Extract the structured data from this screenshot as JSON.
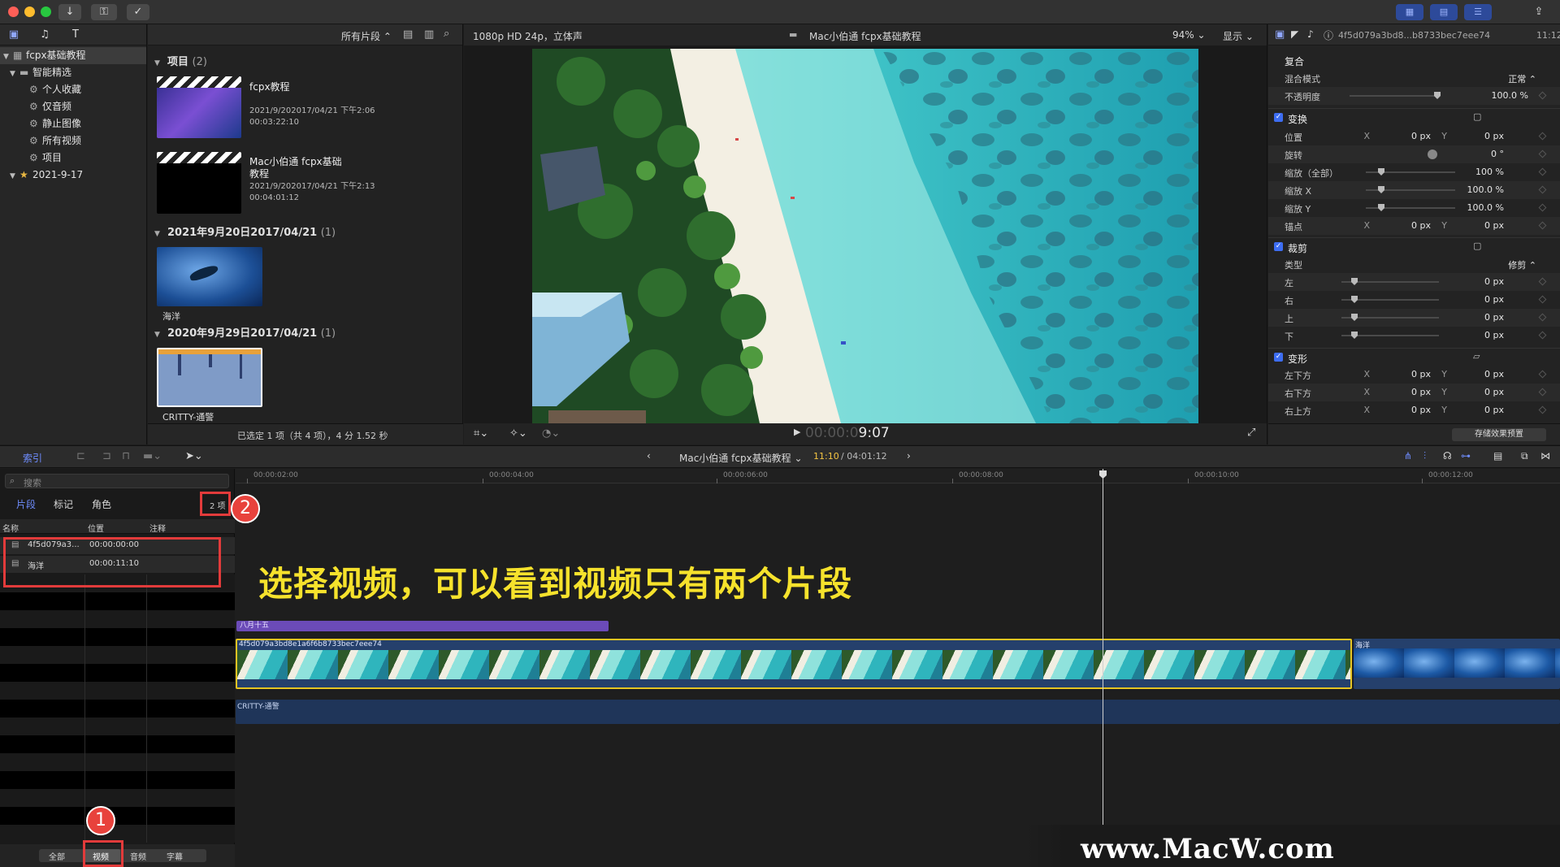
{
  "titlebar": {
    "icons": [
      "download-icon",
      "key-icon",
      "check-circle-icon"
    ],
    "right_icons": [
      "grid-icon",
      "list-icon",
      "sliders-icon",
      "share-icon"
    ]
  },
  "library": {
    "items": [
      {
        "label": "fcpx基础教程",
        "icon": "library-icon",
        "selected": true
      },
      {
        "label": "智能精选",
        "icon": "folder-icon"
      },
      {
        "label": "个人收藏",
        "icon": "gear-icon"
      },
      {
        "label": "仅音频",
        "icon": "gear-icon"
      },
      {
        "label": "静止图像",
        "icon": "gear-icon"
      },
      {
        "label": "所有视频",
        "icon": "gear-icon"
      },
      {
        "label": "项目",
        "icon": "gear-icon"
      },
      {
        "label": "2021-9-17",
        "icon": "event-icon"
      }
    ]
  },
  "browser": {
    "filter": "所有片段 ⌃",
    "projects_header": "项目",
    "projects_count": "(2)",
    "projects": [
      {
        "title": "fcpx教程",
        "date": "2021/9/202017/04/21 下午2:06",
        "duration": "00:03:22:10"
      },
      {
        "title": "Mac小伯通 fcpx基础",
        "title2": "教程",
        "date": "2021/9/202017/04/21 下午2:13",
        "duration": "00:04:01:12"
      }
    ],
    "event1_header": "2021年9月20日2017/04/21",
    "event1_count": "(1)",
    "event1_clip": "海洋",
    "event2_header": "2020年9月29日2017/04/21",
    "event2_count": "(1)",
    "event2_clip": "CRITTY-通警",
    "status": "已选定 1 项（共 4 项），4 分 1.52 秒"
  },
  "viewer": {
    "format": "1080p HD 24p，立体声",
    "title": "Mac小伯通 fcpx基础教程",
    "zoom": "94% ⌄",
    "display": "显示 ⌄",
    "timecode_dim": "00:00:0",
    "timecode": "9:07"
  },
  "inspector": {
    "clip_name": "4f5d079a3bd8...b8733bec7eee74",
    "time": "11:12",
    "sections": {
      "composite": "复合",
      "transform": "变换",
      "crop": "裁剪",
      "distort": "变形"
    },
    "blend_mode_label": "混合模式",
    "blend_mode_value": "正常 ⌃",
    "opacity_label": "不透明度",
    "opacity_value": "100.0 %",
    "position_label": "位置",
    "position_x": "0 px",
    "position_y": "0 px",
    "rotation_label": "旋转",
    "rotation_value": "0 °",
    "scale_all_label": "缩放（全部）",
    "scale_all_value": "100 %",
    "scale_x_label": "缩放 X",
    "scale_x_value": "100.0 %",
    "scale_y_label": "缩放 Y",
    "scale_y_value": "100.0 %",
    "anchor_label": "锚点",
    "anchor_x": "0 px",
    "anchor_y": "0 px",
    "crop_type_label": "类型",
    "crop_type_value": "修剪 ⌃",
    "crop_left_label": "左",
    "crop_right_label": "右",
    "crop_top_label": "上",
    "crop_bottom_label": "下",
    "crop_value": "0 px",
    "bottom_left_label": "左下方",
    "bottom_right_label": "右下方",
    "top_right_label": "右上方",
    "distort_value": "0 px",
    "x": "X",
    "y": "Y",
    "save_preset": "存储效果预置"
  },
  "midbar": {
    "index_label": "索引",
    "project": "Mac小伯通 fcpx基础教程 ⌄",
    "current_time": "11:10",
    "total_time": "/ 04:01:12"
  },
  "index": {
    "search_placeholder": "搜索",
    "tabs": [
      "片段",
      "标记",
      "角色"
    ],
    "count": "2 项",
    "columns": [
      "名称",
      "位置",
      "注释"
    ],
    "rows": [
      {
        "name": "4f5d079a3...",
        "position": "00:00:00:00"
      },
      {
        "name": "海洋",
        "position": "00:00:11:10"
      }
    ],
    "filters": [
      "全部",
      "视频",
      "音频",
      "字幕"
    ]
  },
  "timeline": {
    "ruler": [
      "00:00:02:00",
      "00:00:04:00",
      "00:00:06:00",
      "00:00:08:00",
      "00:00:10:00",
      "00:00:12:00"
    ],
    "annotation": "选择视频，可以看到视频只有两个片段",
    "title_clip": "八月十五",
    "main_clip": "4f5d079a3bd8e1a6f6b8733bec7eee74",
    "second_clip": "海洋",
    "audio_clip": "CRITTY-通警"
  },
  "badges": {
    "one": "1",
    "two": "2"
  },
  "watermark": "www.MacW.com",
  "colors": {
    "accent": "#3d6df2",
    "highlight": "#e8423c",
    "annotation": "#f6e22c",
    "clip_border": "#e6c422"
  }
}
